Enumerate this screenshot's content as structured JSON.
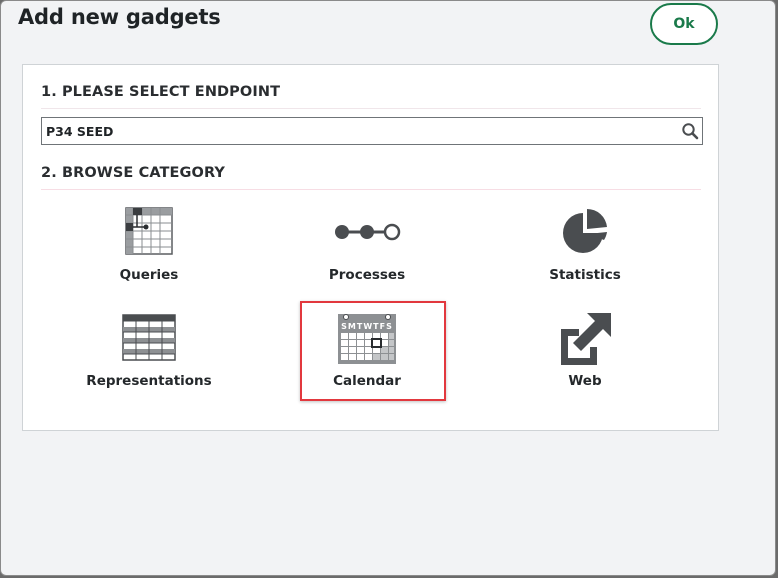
{
  "dialog": {
    "title": "Add new gadgets",
    "ok_label": "Ok"
  },
  "endpoint": {
    "heading": "1. PLEASE SELECT ENDPOINT",
    "value": "P34 SEED",
    "search_icon": "search-icon"
  },
  "browse": {
    "heading": "2. BROWSE CATEGORY",
    "selected": "Calendar",
    "categories": [
      {
        "label": "Queries",
        "icon": "queries-grid-icon"
      },
      {
        "label": "Processes",
        "icon": "processes-flow-icon"
      },
      {
        "label": "Statistics",
        "icon": "pie-chart-icon"
      },
      {
        "label": "Representations",
        "icon": "table-icon"
      },
      {
        "label": "Calendar",
        "icon": "calendar-icon"
      },
      {
        "label": "Web",
        "icon": "external-link-icon"
      }
    ]
  },
  "colors": {
    "accent_green": "#1a7a4a",
    "selection_red": "#e2383e",
    "icon_gray": "#4a4d50"
  }
}
